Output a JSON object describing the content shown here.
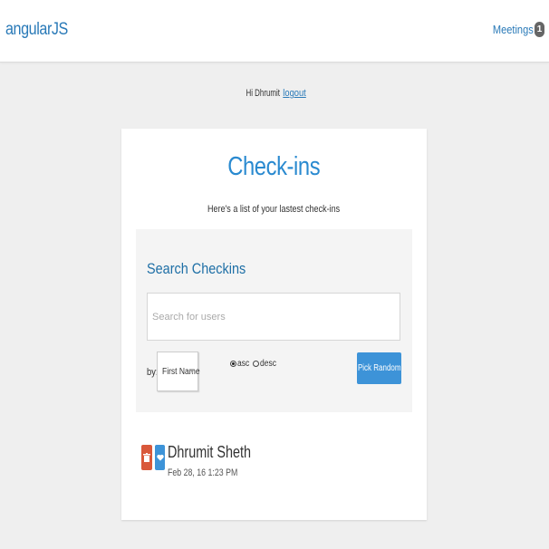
{
  "navbar": {
    "brand": "angularJS",
    "meetings_label": "Meetings",
    "meetings_count": "1"
  },
  "greeting": {
    "text": "Hi Dhrumit ",
    "logout_label": "logout"
  },
  "card": {
    "title": "Check-ins",
    "subtitle": "Here's a list of your lastest check-ins"
  },
  "search": {
    "heading": "Search Checkins",
    "placeholder": "Search for users",
    "by_label": "by:",
    "sort_selected": "First Name",
    "order_options": [
      "asc",
      "desc"
    ],
    "order_selected": "asc",
    "pick_random_label": "Pick Random"
  },
  "checkins": [
    {
      "name": "Dhrumit Sheth",
      "date": "Feb 28, 16 1:23 PM"
    }
  ],
  "colors": {
    "brand_blue": "#2a7ab8",
    "title_blue": "#2a8ad0",
    "button_blue": "#3d93d8",
    "delete_red": "#d9583a",
    "badge_gray": "#666666",
    "background": "#efefef"
  },
  "icons": {
    "pick_random": "dice-icon",
    "delete": "trash-icon",
    "favorite": "heart-icon"
  }
}
